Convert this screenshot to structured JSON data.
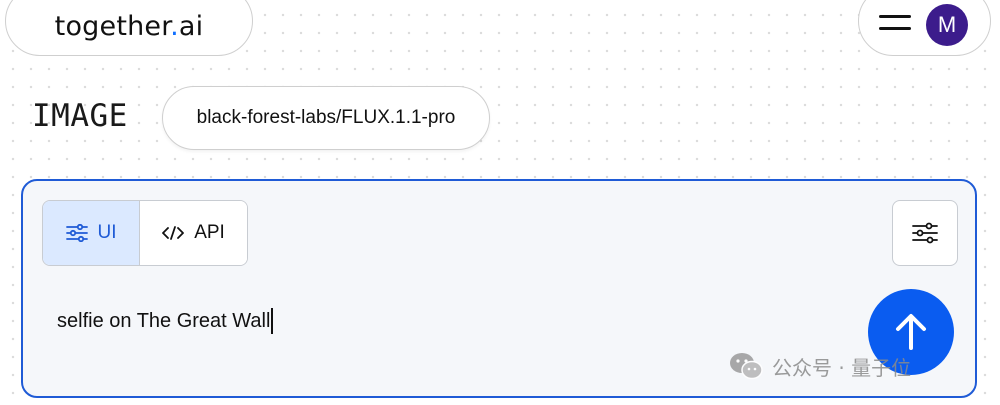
{
  "header": {
    "logo": {
      "text_main": "together",
      "text_dot": ".",
      "text_suffix": "ai"
    },
    "menu_icon": "hamburger-icon",
    "avatar_initial": "M"
  },
  "toolbar": {
    "section_label": "IMAGE",
    "model": "black-forest-labs/FLUX.1.1-pro"
  },
  "prompt_card": {
    "modes": [
      {
        "label": "UI",
        "icon": "sliders-icon",
        "selected": true
      },
      {
        "label": "API",
        "icon": "code-icon",
        "selected": false
      }
    ],
    "settings_icon": "sliders-icon",
    "prompt_value": "selfie on The Great Wall",
    "submit_icon": "arrow-up-icon"
  },
  "watermark": {
    "text": "公众号 · 量子位"
  },
  "colors": {
    "accent": "#1f5bd6",
    "submit": "#0a5cf0",
    "avatar": "#3c1c8c",
    "selected_bg": "#dbe9ff",
    "logo_dot": "#0f6fff"
  }
}
